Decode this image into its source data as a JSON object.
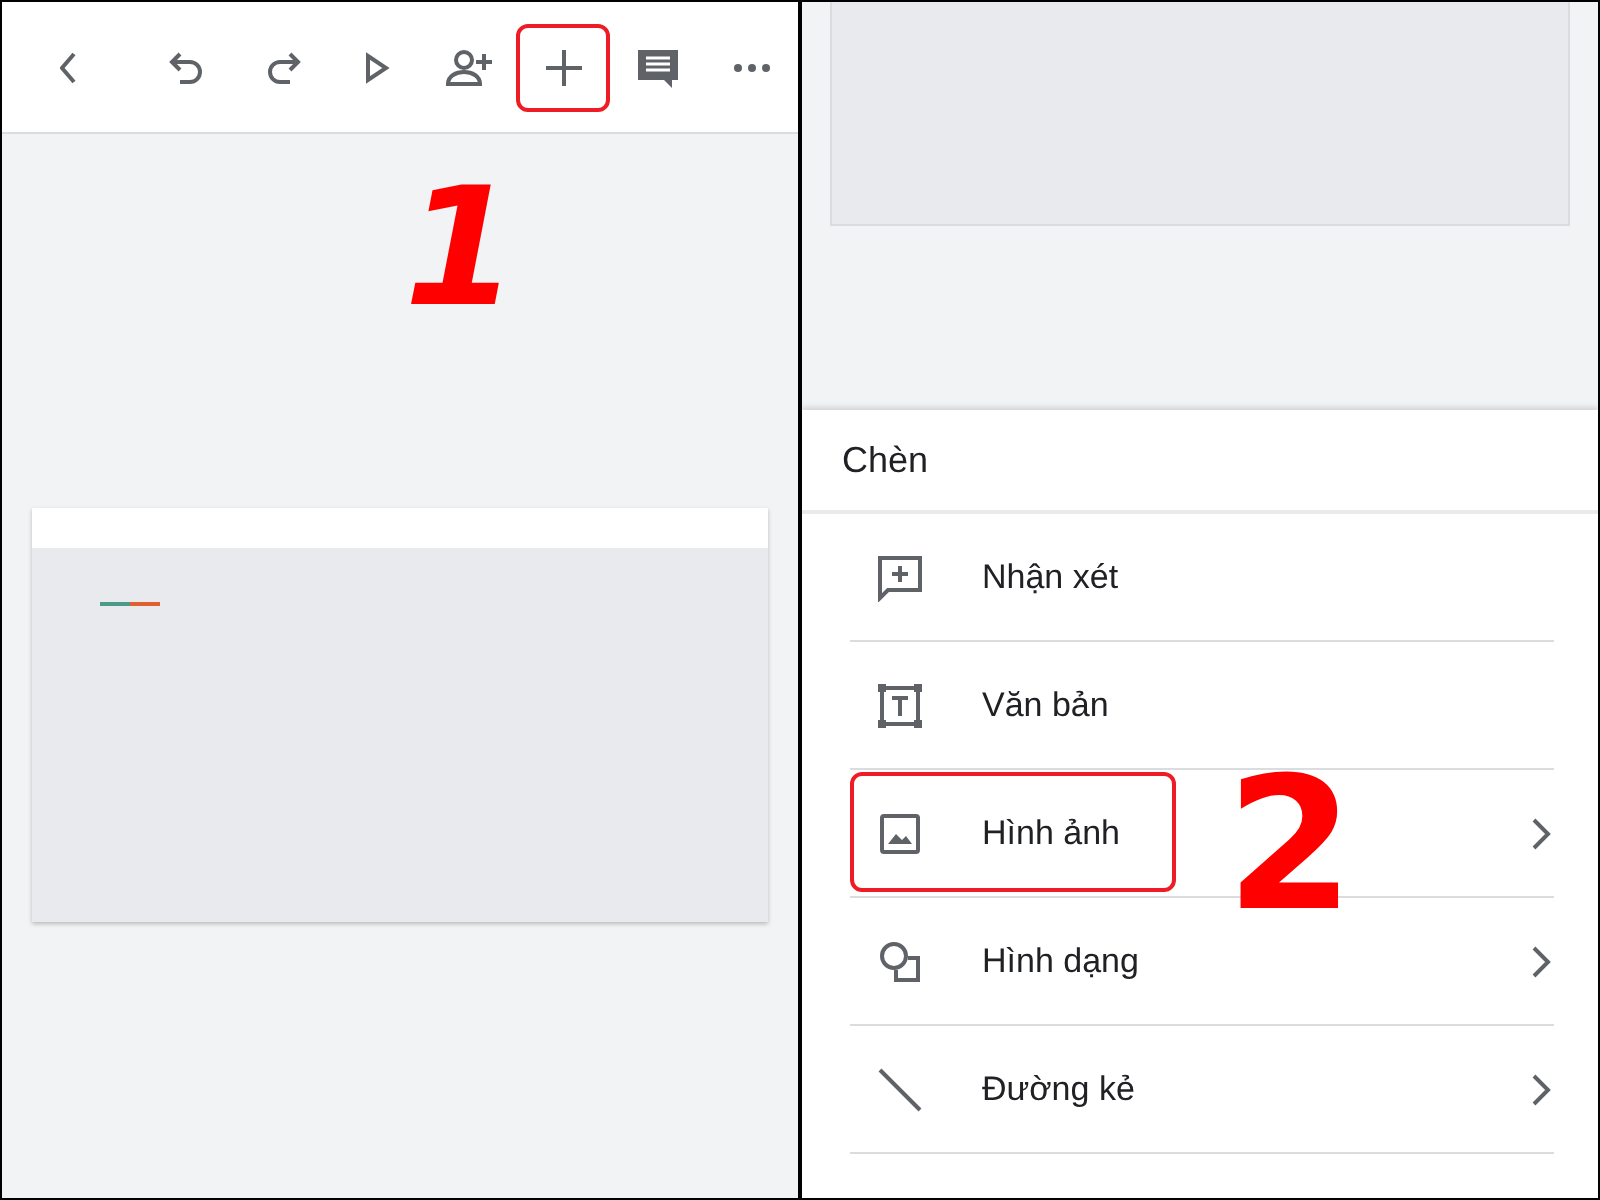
{
  "toolbar": {
    "items": [
      {
        "kind": "back"
      },
      {
        "kind": "undo"
      },
      {
        "kind": "redo"
      },
      {
        "kind": "play"
      },
      {
        "kind": "add-person"
      },
      {
        "kind": "plus",
        "callout": "1"
      },
      {
        "kind": "comment"
      },
      {
        "kind": "more"
      }
    ]
  },
  "insert_menu": {
    "title": "Chèn",
    "items": [
      {
        "kind": "comment-plus",
        "label": "Nhận xét",
        "submenu": false
      },
      {
        "kind": "text-box",
        "label": "Văn bản",
        "submenu": false
      },
      {
        "kind": "image",
        "label": "Hình ảnh",
        "submenu": true,
        "callout": "2"
      },
      {
        "kind": "shapes",
        "label": "Hình dạng",
        "submenu": true
      },
      {
        "kind": "line",
        "label": "Đường kẻ",
        "submenu": true
      }
    ]
  }
}
